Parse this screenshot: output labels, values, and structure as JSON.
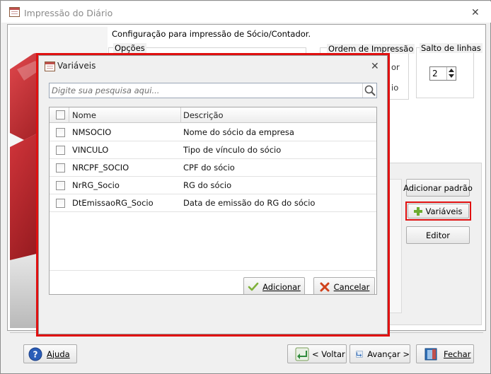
{
  "window": {
    "title": "Impressão do Diário",
    "close_glyph": "✕"
  },
  "main": {
    "config_label": "Configuração para impressão de Sócio/Contador.",
    "options_legend": "Opções",
    "order_legend": "Ordem de Impressão",
    "order_partial_1": "or",
    "order_partial_2": "io",
    "line_jump_legend": "Salto de linhas",
    "line_jump_value": "2",
    "right_buttons": {
      "add_default": "Adicionar padrão",
      "variables": "Variáveis",
      "editor": "Editor"
    }
  },
  "footer": {
    "help": "Ajuda",
    "back": "< Voltar",
    "next": "Avançar >",
    "close": "Fechar"
  },
  "modal": {
    "title": "Variáveis",
    "close_glyph": "✕",
    "search_placeholder": "Digite sua pesquisa aqui...",
    "columns": [
      "Nome",
      "Descrição"
    ],
    "rows": [
      {
        "name": "NMSOCIO",
        "description": "Nome do sócio da empresa"
      },
      {
        "name": "VINCULO",
        "description": "Tipo de vínculo do sócio"
      },
      {
        "name": "NRCPF_SOCIO",
        "description": "CPF do sócio"
      },
      {
        "name": "NrRG_Socio",
        "description": "RG do sócio"
      },
      {
        "name": "DtEmissaoRG_Socio",
        "description": "Data de emissão do RG do sócio"
      }
    ],
    "add_button": "Adicionar",
    "cancel_button": "Cancelar"
  },
  "colors": {
    "highlight": "#e01010",
    "puzzle_red": "#c8282f",
    "plus_green": "#6cab2e",
    "help_blue": "#2a5db8"
  },
  "icons": {
    "app": "diary-book-icon",
    "search": "search-icon",
    "variables": "plus-icon",
    "help": "help-icon",
    "back": "back-arrow-icon",
    "next": "next-arrow-icon",
    "close": "close-door-icon",
    "add": "check-icon",
    "cancel": "cancel-x-icon"
  }
}
